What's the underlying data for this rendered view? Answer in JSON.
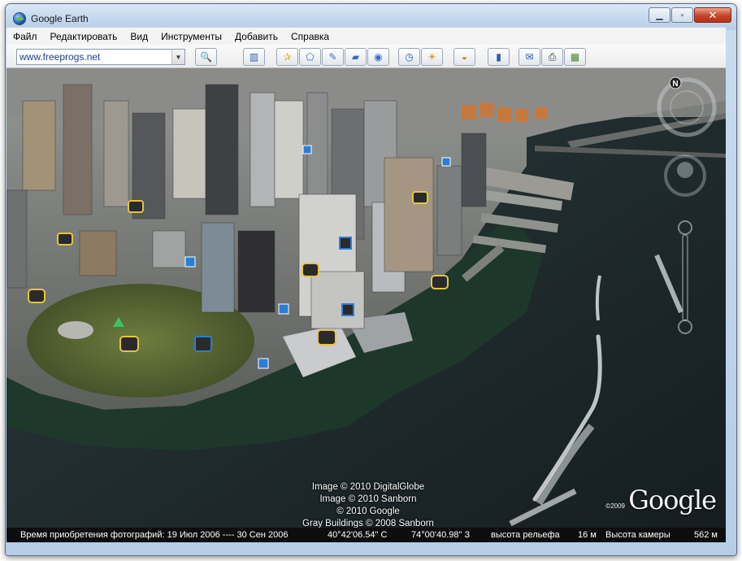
{
  "window": {
    "title": "Google Earth",
    "controls": {
      "minimize": "▁",
      "maximize": "▫",
      "close": "✕"
    }
  },
  "menu": {
    "items": [
      "Файл",
      "Редактировать",
      "Вид",
      "Инструменты",
      "Добавить",
      "Справка"
    ]
  },
  "toolbar": {
    "search_value": "www.freeprogs.net",
    "buttons": [
      {
        "name": "search-icon",
        "glyph": "🔍"
      },
      {
        "name": "sidebar-icon",
        "glyph": "▥"
      },
      {
        "name": "placemark-icon",
        "glyph": "✰"
      },
      {
        "name": "polygon-icon",
        "glyph": "⬠"
      },
      {
        "name": "path-icon",
        "glyph": "✎"
      },
      {
        "name": "image-overlay-icon",
        "glyph": "▰"
      },
      {
        "name": "record-tour-icon",
        "glyph": "◉"
      },
      {
        "name": "historical-imagery-icon",
        "glyph": "◷"
      },
      {
        "name": "sunlight-icon",
        "glyph": "☀"
      },
      {
        "name": "planet-icon",
        "glyph": "◒"
      },
      {
        "name": "ruler-icon",
        "glyph": "▮"
      },
      {
        "name": "email-icon",
        "glyph": "✉"
      },
      {
        "name": "print-icon",
        "glyph": "⎙"
      },
      {
        "name": "map-view-icon",
        "glyph": "▦"
      }
    ]
  },
  "viewport": {
    "credits": [
      "Image © 2010 DigitalGlobe",
      "Image © 2010 Sanborn",
      "© 2010 Google",
      "Gray Buildings © 2008 Sanborn"
    ],
    "logo": "Google",
    "logo_year": "©2009"
  },
  "status": {
    "imagery_date": "Время приобретения фотографий: 19 Июл 2006 ---- 30 Сен 2006",
    "latitude": "40°42'06.54\" С",
    "longitude": "74°00'40.98\" З",
    "elevation_label": "высота рельефа",
    "elevation_value": "16 м",
    "eye_alt_label": "Высота камеры",
    "eye_alt_value": "562 м"
  }
}
